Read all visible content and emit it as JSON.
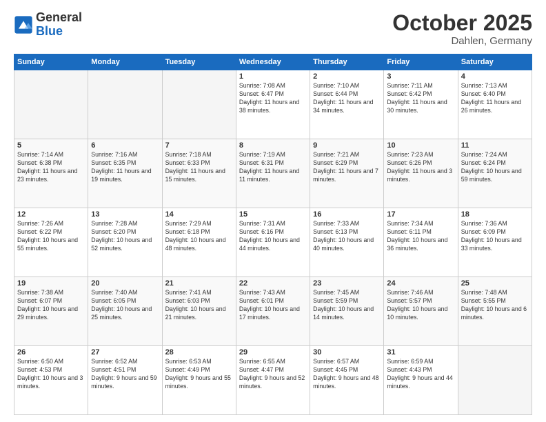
{
  "header": {
    "logo_general": "General",
    "logo_blue": "Blue",
    "month_title": "October 2025",
    "location": "Dahlen, Germany"
  },
  "days_of_week": [
    "Sunday",
    "Monday",
    "Tuesday",
    "Wednesday",
    "Thursday",
    "Friday",
    "Saturday"
  ],
  "weeks": [
    [
      {
        "day": "",
        "empty": true
      },
      {
        "day": "",
        "empty": true
      },
      {
        "day": "",
        "empty": true
      },
      {
        "day": "1",
        "sunrise": "7:08 AM",
        "sunset": "6:47 PM",
        "daylight": "11 hours and 38 minutes."
      },
      {
        "day": "2",
        "sunrise": "7:10 AM",
        "sunset": "6:44 PM",
        "daylight": "11 hours and 34 minutes."
      },
      {
        "day": "3",
        "sunrise": "7:11 AM",
        "sunset": "6:42 PM",
        "daylight": "11 hours and 30 minutes."
      },
      {
        "day": "4",
        "sunrise": "7:13 AM",
        "sunset": "6:40 PM",
        "daylight": "11 hours and 26 minutes."
      }
    ],
    [
      {
        "day": "5",
        "sunrise": "7:14 AM",
        "sunset": "6:38 PM",
        "daylight": "11 hours and 23 minutes."
      },
      {
        "day": "6",
        "sunrise": "7:16 AM",
        "sunset": "6:35 PM",
        "daylight": "11 hours and 19 minutes."
      },
      {
        "day": "7",
        "sunrise": "7:18 AM",
        "sunset": "6:33 PM",
        "daylight": "11 hours and 15 minutes."
      },
      {
        "day": "8",
        "sunrise": "7:19 AM",
        "sunset": "6:31 PM",
        "daylight": "11 hours and 11 minutes."
      },
      {
        "day": "9",
        "sunrise": "7:21 AM",
        "sunset": "6:29 PM",
        "daylight": "11 hours and 7 minutes."
      },
      {
        "day": "10",
        "sunrise": "7:23 AM",
        "sunset": "6:26 PM",
        "daylight": "11 hours and 3 minutes."
      },
      {
        "day": "11",
        "sunrise": "7:24 AM",
        "sunset": "6:24 PM",
        "daylight": "10 hours and 59 minutes."
      }
    ],
    [
      {
        "day": "12",
        "sunrise": "7:26 AM",
        "sunset": "6:22 PM",
        "daylight": "10 hours and 55 minutes."
      },
      {
        "day": "13",
        "sunrise": "7:28 AM",
        "sunset": "6:20 PM",
        "daylight": "10 hours and 52 minutes."
      },
      {
        "day": "14",
        "sunrise": "7:29 AM",
        "sunset": "6:18 PM",
        "daylight": "10 hours and 48 minutes."
      },
      {
        "day": "15",
        "sunrise": "7:31 AM",
        "sunset": "6:16 PM",
        "daylight": "10 hours and 44 minutes."
      },
      {
        "day": "16",
        "sunrise": "7:33 AM",
        "sunset": "6:13 PM",
        "daylight": "10 hours and 40 minutes."
      },
      {
        "day": "17",
        "sunrise": "7:34 AM",
        "sunset": "6:11 PM",
        "daylight": "10 hours and 36 minutes."
      },
      {
        "day": "18",
        "sunrise": "7:36 AM",
        "sunset": "6:09 PM",
        "daylight": "10 hours and 33 minutes."
      }
    ],
    [
      {
        "day": "19",
        "sunrise": "7:38 AM",
        "sunset": "6:07 PM",
        "daylight": "10 hours and 29 minutes."
      },
      {
        "day": "20",
        "sunrise": "7:40 AM",
        "sunset": "6:05 PM",
        "daylight": "10 hours and 25 minutes."
      },
      {
        "day": "21",
        "sunrise": "7:41 AM",
        "sunset": "6:03 PM",
        "daylight": "10 hours and 21 minutes."
      },
      {
        "day": "22",
        "sunrise": "7:43 AM",
        "sunset": "6:01 PM",
        "daylight": "10 hours and 17 minutes."
      },
      {
        "day": "23",
        "sunrise": "7:45 AM",
        "sunset": "5:59 PM",
        "daylight": "10 hours and 14 minutes."
      },
      {
        "day": "24",
        "sunrise": "7:46 AM",
        "sunset": "5:57 PM",
        "daylight": "10 hours and 10 minutes."
      },
      {
        "day": "25",
        "sunrise": "7:48 AM",
        "sunset": "5:55 PM",
        "daylight": "10 hours and 6 minutes."
      }
    ],
    [
      {
        "day": "26",
        "sunrise": "6:50 AM",
        "sunset": "4:53 PM",
        "daylight": "10 hours and 3 minutes."
      },
      {
        "day": "27",
        "sunrise": "6:52 AM",
        "sunset": "4:51 PM",
        "daylight": "9 hours and 59 minutes."
      },
      {
        "day": "28",
        "sunrise": "6:53 AM",
        "sunset": "4:49 PM",
        "daylight": "9 hours and 55 minutes."
      },
      {
        "day": "29",
        "sunrise": "6:55 AM",
        "sunset": "4:47 PM",
        "daylight": "9 hours and 52 minutes."
      },
      {
        "day": "30",
        "sunrise": "6:57 AM",
        "sunset": "4:45 PM",
        "daylight": "9 hours and 48 minutes."
      },
      {
        "day": "31",
        "sunrise": "6:59 AM",
        "sunset": "4:43 PM",
        "daylight": "9 hours and 44 minutes."
      },
      {
        "day": "",
        "empty": true
      }
    ]
  ],
  "labels": {
    "sunrise": "Sunrise:",
    "sunset": "Sunset:",
    "daylight": "Daylight:"
  }
}
